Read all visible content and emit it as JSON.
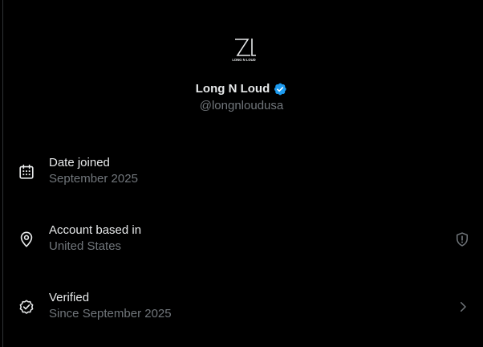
{
  "profile": {
    "logo_text": "LONG N LOUD",
    "display_name": "Long N Loud",
    "verified": true,
    "handle": "@longnloudusa"
  },
  "rows": [
    {
      "icon": "calendar-icon",
      "title": "Date joined",
      "subtitle": "September 2025",
      "right_icon": null
    },
    {
      "icon": "location-pin-icon",
      "title": "Account based in",
      "subtitle": "United States",
      "right_icon": "shield-alert-icon"
    },
    {
      "icon": "verified-check-icon",
      "title": "Verified",
      "subtitle": "Since September 2025",
      "right_icon": "chevron-right-icon"
    }
  ],
  "colors": {
    "background": "#000000",
    "primary_text": "#e7e9ea",
    "secondary_text": "#71767b",
    "verified_blue": "#1d9bf0",
    "border": "#2f3336"
  }
}
